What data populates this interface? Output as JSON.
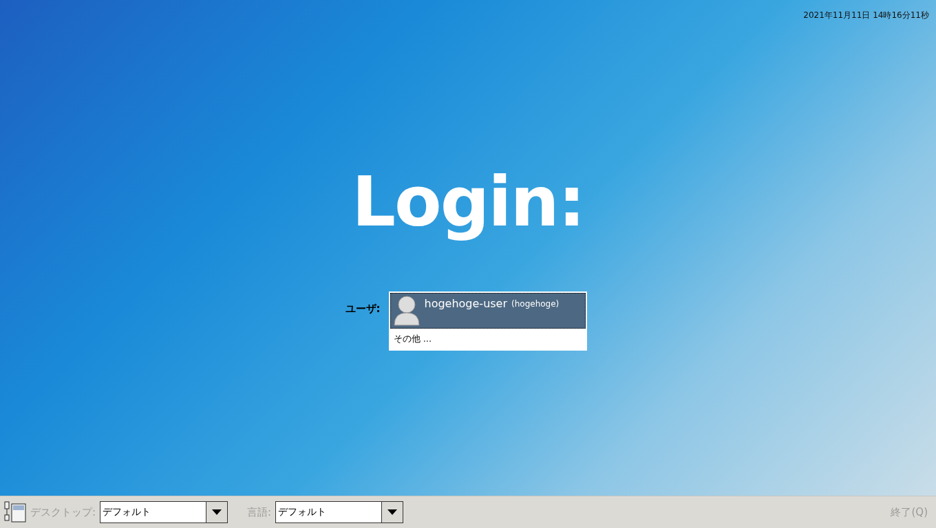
{
  "clock": "2021年11月11日 14時16分11秒",
  "title": "Login:",
  "user_list": {
    "label": "ユーザ:",
    "items": [
      {
        "kind": "user",
        "name": "hogehoge-user",
        "login": "(hogehoge)",
        "selected": true
      },
      {
        "kind": "other",
        "name": "その他 ...",
        "selected": false
      }
    ]
  },
  "bottom_bar": {
    "desktop": {
      "label": "デスクトップ:",
      "value": "デフォルト"
    },
    "language": {
      "label": "言語:",
      "value": "デフォルト"
    },
    "quit": "終了(Q)"
  }
}
